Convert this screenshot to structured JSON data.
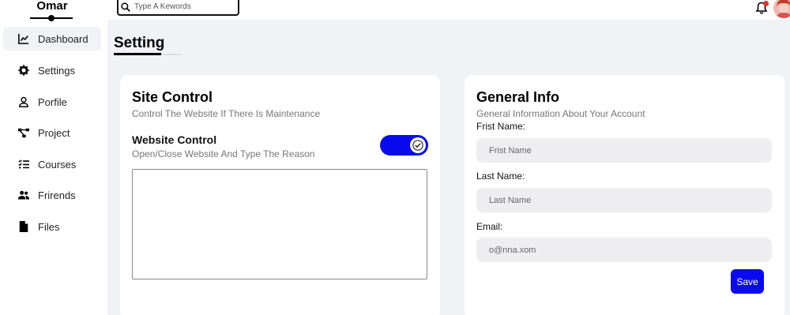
{
  "brand": {
    "name": "Omar"
  },
  "search": {
    "placeholder": "Type A Kewords"
  },
  "sidebar": {
    "items": [
      {
        "label": "Dashboard",
        "icon": "chart-line-icon"
      },
      {
        "label": "Settings",
        "icon": "gear-icon"
      },
      {
        "label": "Porfile",
        "icon": "user-icon"
      },
      {
        "label": "Project",
        "icon": "diagram-icon"
      },
      {
        "label": "Courses",
        "icon": "list-check-icon"
      },
      {
        "label": "Frirends",
        "icon": "users-icon"
      },
      {
        "label": "Files",
        "icon": "file-icon"
      }
    ]
  },
  "page": {
    "title": "Setting"
  },
  "site_control": {
    "title": "Site Control",
    "subtitle": "Control The Website If There Is Maintenance",
    "website_control_label": "Website Control",
    "website_control_desc": "Open/Close Website And Type The Reason",
    "toggle_on": true,
    "reason_value": ""
  },
  "general_info": {
    "title": "General Info",
    "subtitle": "General Information About Your Account",
    "first_name_label": "Frist Name:",
    "first_name_placeholder": "Frist Name",
    "last_name_label": "Last Name:",
    "last_name_placeholder": "Last Name",
    "email_label": "Email:",
    "email_placeholder": "o@nna.xom",
    "save_label": "Save"
  },
  "colors": {
    "accent": "#0a0af0",
    "content_bg": "#f1f2f5",
    "notification": "#e5322c"
  }
}
